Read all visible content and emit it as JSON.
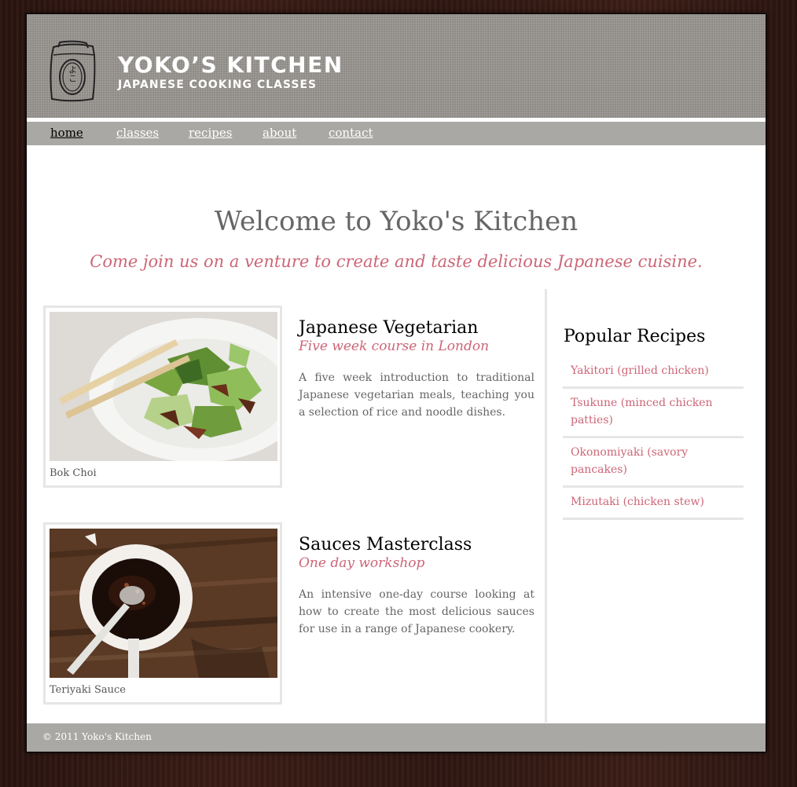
{
  "header": {
    "logo_glyphs": "よこ",
    "title": "YOKO’S KITCHEN",
    "subtitle": "JAPANESE COOKING CLASSES"
  },
  "nav": {
    "items": [
      {
        "label": "home",
        "current": true
      },
      {
        "label": "classes",
        "current": false
      },
      {
        "label": "recipes",
        "current": false
      },
      {
        "label": "about",
        "current": false
      },
      {
        "label": "contact",
        "current": false
      }
    ]
  },
  "main": {
    "heading": "Welcome to Yoko's Kitchen",
    "intro": "Come join us on a venture to create and taste delicious Japanese cuisine.",
    "courses": [
      {
        "image_caption": "Bok Choi",
        "title": "Japanese Vegetarian",
        "subtitle": "Five week course in London",
        "description": "A five week introduction to traditional Japanese vegetarian meals, teaching you a selection of rice and noodle dishes."
      },
      {
        "image_caption": "Teriyaki Sauce",
        "title": "Sauces Masterclass",
        "subtitle": "One day workshop",
        "description": "An intensive one-day course looking at how to create the most delicious sauces for use in a range of Japanese cookery."
      }
    ]
  },
  "sidebar": {
    "title": "Popular Recipes",
    "recipes": [
      "Yakitori (grilled chicken)",
      "Tsukune (minced chicken patties)",
      "Okonomiyaki (savory pancakes)",
      "Mizutaki (chicken stew)"
    ]
  },
  "footer": {
    "copyright": "© 2011 Yoko's Kitchen"
  },
  "colors": {
    "accent_pink": "#cc6677",
    "nav_bar": "#aaa8a4",
    "header_bg": "#9c9893",
    "wood_bg": "#2f1712"
  },
  "icons": {
    "logo": "rice-bag-icon"
  }
}
